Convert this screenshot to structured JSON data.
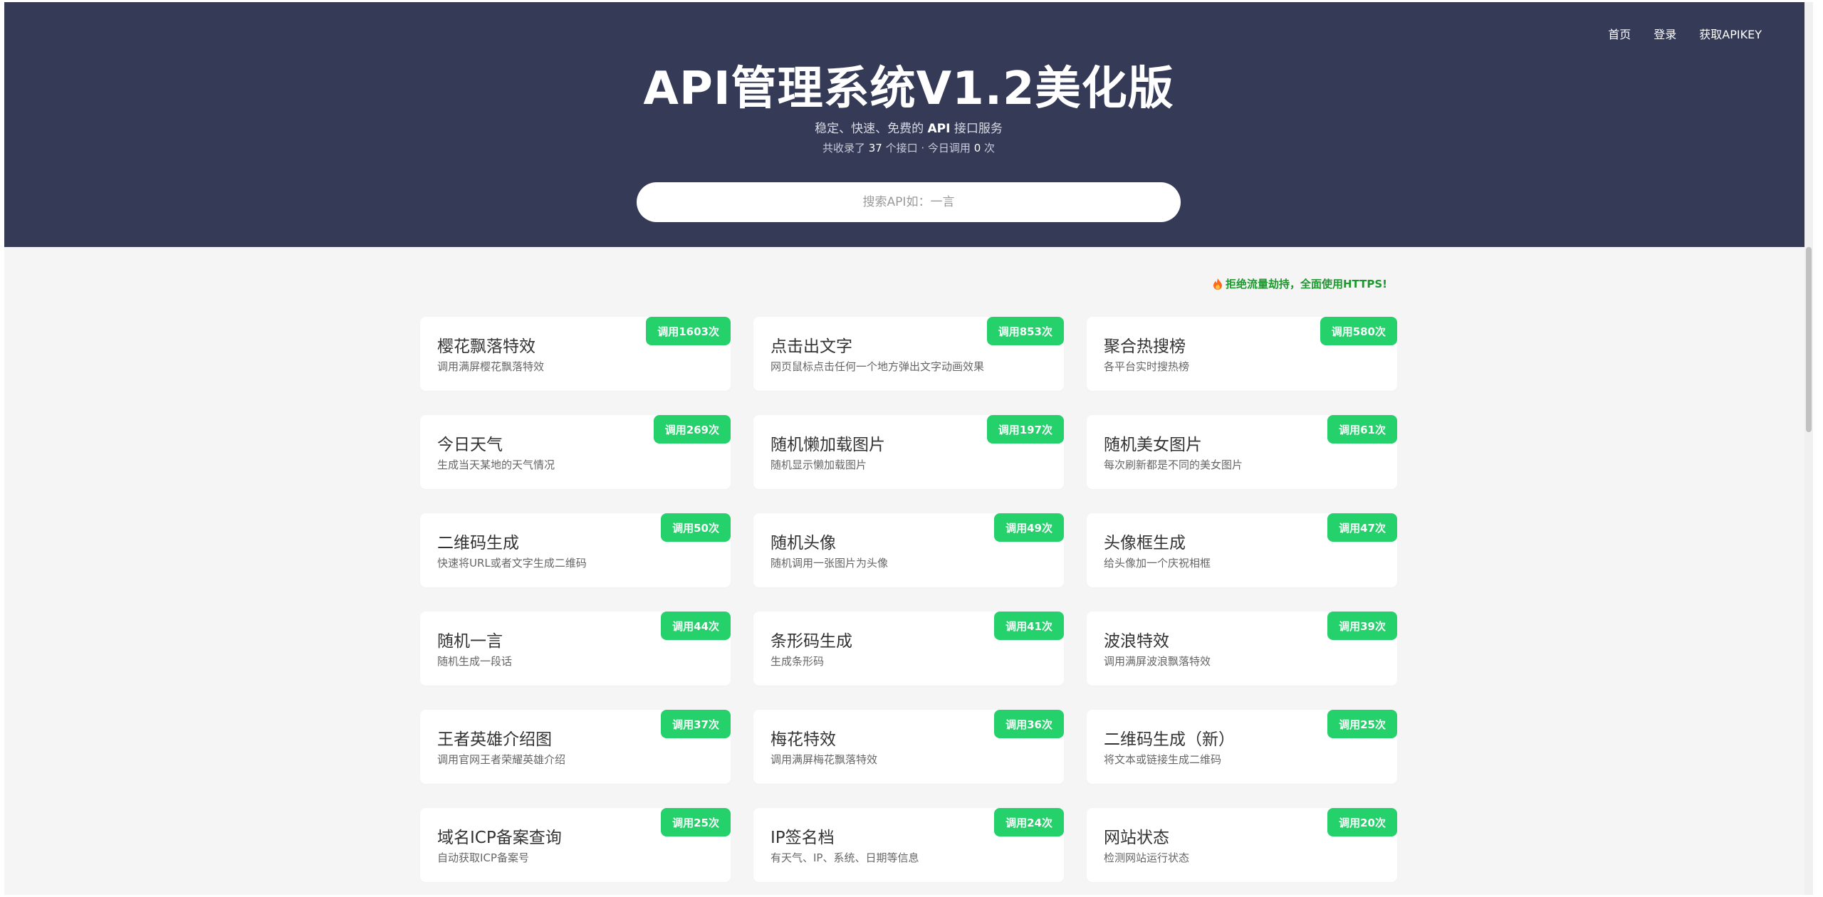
{
  "nav": {
    "home": "首页",
    "login": "登录",
    "get_key": "获取APIKEY"
  },
  "hero": {
    "title": "API管理系统V1.2美化版",
    "subtitle_pre": "稳定、快速、免费的 ",
    "subtitle_api": "API",
    "subtitle_post": " 接口服务",
    "stats_pre": "共收录了 ",
    "api_count": "37",
    "stats_mid": " 个接口 · 今日调用 ",
    "today_calls": "0",
    "stats_post": " 次"
  },
  "search": {
    "placeholder": "搜索API如：一言"
  },
  "notice": {
    "icon": "fire-icon",
    "text": "拒绝流量劫持，全面使用HTTPS!"
  },
  "colors": {
    "header_bg": "#353a56",
    "badge": "#25d16a",
    "notice": "#1a9a2c"
  },
  "apis": [
    {
      "title": "樱花飘落特效",
      "desc": "调用满屏樱花飘落特效",
      "calls": "调用1603次"
    },
    {
      "title": "点击出文字",
      "desc": "网页鼠标点击任何一个地方弹出文字动画效果",
      "calls": "调用853次"
    },
    {
      "title": "聚合热搜榜",
      "desc": "各平台实时搜热榜",
      "calls": "调用580次"
    },
    {
      "title": "今日天气",
      "desc": "生成当天某地的天气情况",
      "calls": "调用269次"
    },
    {
      "title": "随机懒加载图片",
      "desc": "随机显示懒加载图片",
      "calls": "调用197次"
    },
    {
      "title": "随机美女图片",
      "desc": "每次刷新都是不同的美女图片",
      "calls": "调用61次"
    },
    {
      "title": "二维码生成",
      "desc": "快速将URL或者文字生成二维码",
      "calls": "调用50次"
    },
    {
      "title": "随机头像",
      "desc": "随机调用一张图片为头像",
      "calls": "调用49次"
    },
    {
      "title": "头像框生成",
      "desc": "给头像加一个庆祝相框",
      "calls": "调用47次"
    },
    {
      "title": "随机一言",
      "desc": "随机生成一段话",
      "calls": "调用44次"
    },
    {
      "title": "条形码生成",
      "desc": "生成条形码",
      "calls": "调用41次"
    },
    {
      "title": "波浪特效",
      "desc": "调用满屏波浪飘落特效",
      "calls": "调用39次"
    },
    {
      "title": "王者英雄介绍图",
      "desc": "调用官网王者荣耀英雄介绍",
      "calls": "调用37次"
    },
    {
      "title": "梅花特效",
      "desc": "调用满屏梅花飘落特效",
      "calls": "调用36次"
    },
    {
      "title": "二维码生成（新）",
      "desc": "将文本或链接生成二维码",
      "calls": "调用25次"
    },
    {
      "title": "域名ICP备案查询",
      "desc": "自动获取ICP备案号",
      "calls": "调用25次"
    },
    {
      "title": "IP签名档",
      "desc": "有天气、IP、系统、日期等信息",
      "calls": "调用24次"
    },
    {
      "title": "网站状态",
      "desc": "检测网站运行状态",
      "calls": "调用20次"
    }
  ]
}
